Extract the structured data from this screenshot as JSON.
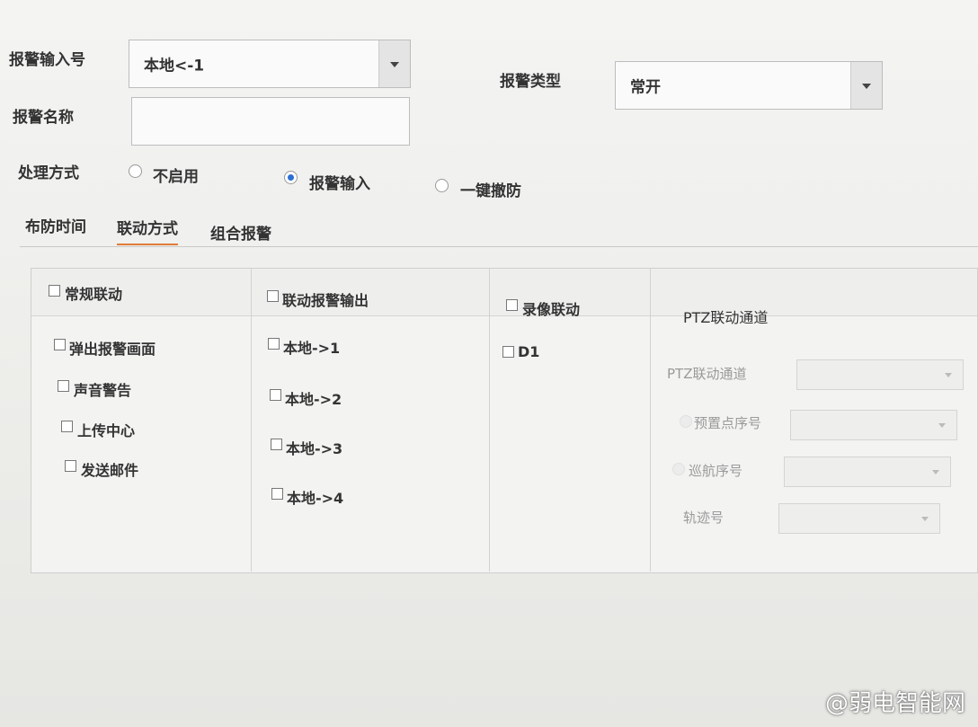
{
  "form": {
    "alarm_input_label": "报警输入号",
    "alarm_input_value": "本地<-1",
    "alarm_type_label": "报警类型",
    "alarm_type_value": "常开",
    "alarm_name_label": "报警名称",
    "alarm_name_value": "",
    "handling_label": "处理方式",
    "handling_options": [
      "不启用",
      "报警输入",
      "一键撤防"
    ],
    "handling_selected": "报警输入"
  },
  "tabs": [
    "布防时间",
    "联动方式",
    "组合报警"
  ],
  "active_tab": "联动方式",
  "columns": {
    "general": {
      "header": "常规联动",
      "items": [
        "弹出报警画面",
        "声音警告",
        "上传中心",
        "发送邮件"
      ]
    },
    "alarm_output": {
      "header": "联动报警输出",
      "items": [
        "本地->1",
        "本地->2",
        "本地->3",
        "本地->4"
      ]
    },
    "record": {
      "header": "录像联动",
      "items": [
        "D1"
      ]
    },
    "ptz": {
      "header": "PTZ联动通道",
      "fields": [
        "PTZ联动通道",
        "预置点序号",
        "巡航序号",
        "轨迹号"
      ]
    }
  },
  "watermark": "@弱电智能网"
}
